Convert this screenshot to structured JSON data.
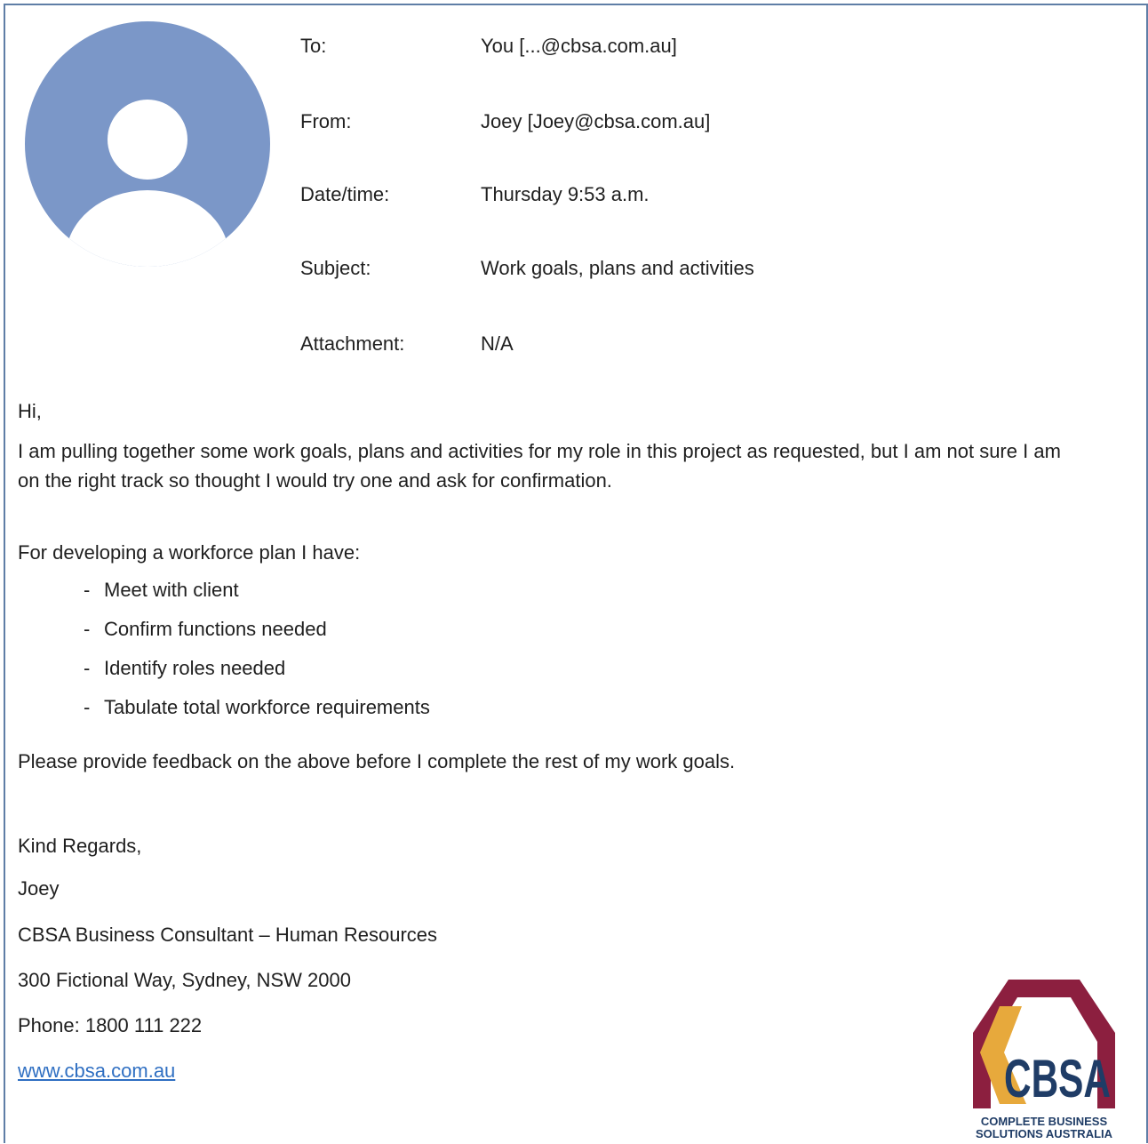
{
  "header": {
    "to": {
      "label": "To:",
      "value": "You [...@cbsa.com.au]"
    },
    "from": {
      "label": "From:",
      "value": "Joey [Joey@cbsa.com.au]"
    },
    "datetime": {
      "label": "Date/time:",
      "value": "Thursday 9:53 a.m."
    },
    "subject": {
      "label": "Subject:",
      "value": "Work goals, plans and activities"
    },
    "attachment": {
      "label": "Attachment:",
      "value": "N/A"
    }
  },
  "body": {
    "greeting": "Hi,",
    "paragraph1": "I am pulling together some work goals, plans and activities for my role in this project as requested, but I am not sure I am on the right track so thought I would try one and ask for confirmation.",
    "list_intro": "For developing a workforce plan I have:",
    "bullet_marker": "-",
    "list_items": [
      "Meet with client",
      "Confirm functions needed",
      "Identify roles needed",
      "Tabulate total workforce requirements"
    ],
    "closing_request": "Please provide feedback on the above before I complete the rest of my work goals."
  },
  "signature": {
    "sign_off": "Kind Regards,",
    "name": "Joey",
    "title": "CBSA Business Consultant – Human Resources",
    "address": "300 Fictional Way, Sydney, NSW 2000",
    "phone": "Phone: 1800 111 222",
    "website": "www.cbsa.com.au"
  },
  "logo": {
    "text": "CBSA",
    "tagline_line1": "COMPLETE BUSINESS",
    "tagline_line2": "SOLUTIONS AUSTRALIA"
  },
  "colors": {
    "frame_border": "#5f7ea6",
    "avatar_bg": "#7b97c8",
    "link": "#2f6fc2",
    "logo_maroon": "#8c1f3f",
    "logo_gold": "#e7a93c",
    "logo_text": "#1f3c66"
  },
  "icons": {
    "avatar": "user-avatar-icon",
    "logo": "cbsa-logo"
  }
}
